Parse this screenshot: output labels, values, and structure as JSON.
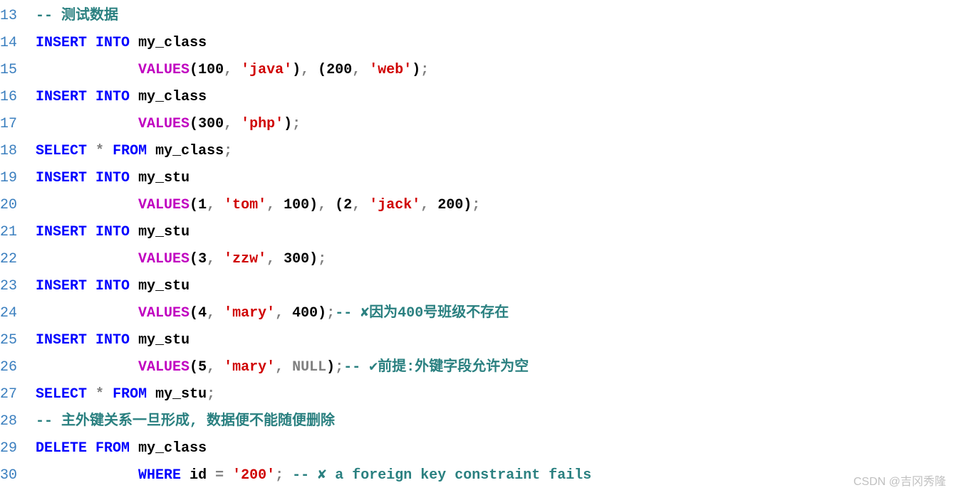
{
  "lines": [
    {
      "no": "13",
      "tokens": [
        {
          "t": "-- 测试数据",
          "c": "comment"
        }
      ]
    },
    {
      "no": "14",
      "tokens": [
        {
          "t": "INSERT",
          "c": "kw"
        },
        {
          "t": " ",
          "c": "id"
        },
        {
          "t": "INTO",
          "c": "kw"
        },
        {
          "t": " ",
          "c": "id"
        },
        {
          "t": "my_class",
          "c": "id"
        }
      ]
    },
    {
      "no": "15",
      "indent": "            ",
      "tokens": [
        {
          "t": "VALUES",
          "c": "fn"
        },
        {
          "t": "(",
          "c": "punct"
        },
        {
          "t": "100",
          "c": "num"
        },
        {
          "t": ",",
          "c": "op"
        },
        {
          "t": " ",
          "c": "id"
        },
        {
          "t": "'java'",
          "c": "str"
        },
        {
          "t": ")",
          "c": "punct"
        },
        {
          "t": ",",
          "c": "op"
        },
        {
          "t": " ",
          "c": "id"
        },
        {
          "t": "(",
          "c": "punct"
        },
        {
          "t": "200",
          "c": "num"
        },
        {
          "t": ",",
          "c": "op"
        },
        {
          "t": " ",
          "c": "id"
        },
        {
          "t": "'web'",
          "c": "str"
        },
        {
          "t": ")",
          "c": "punct"
        },
        {
          "t": ";",
          "c": "op"
        }
      ]
    },
    {
      "no": "16",
      "tokens": [
        {
          "t": "INSERT",
          "c": "kw"
        },
        {
          "t": " ",
          "c": "id"
        },
        {
          "t": "INTO",
          "c": "kw"
        },
        {
          "t": " ",
          "c": "id"
        },
        {
          "t": "my_class",
          "c": "id"
        }
      ]
    },
    {
      "no": "17",
      "indent": "            ",
      "tokens": [
        {
          "t": "VALUES",
          "c": "fn"
        },
        {
          "t": "(",
          "c": "punct"
        },
        {
          "t": "300",
          "c": "num"
        },
        {
          "t": ",",
          "c": "op"
        },
        {
          "t": " ",
          "c": "id"
        },
        {
          "t": "'php'",
          "c": "str"
        },
        {
          "t": ")",
          "c": "punct"
        },
        {
          "t": ";",
          "c": "op"
        }
      ]
    },
    {
      "no": "18",
      "tokens": [
        {
          "t": "SELECT",
          "c": "kw"
        },
        {
          "t": " ",
          "c": "id"
        },
        {
          "t": "*",
          "c": "op"
        },
        {
          "t": " ",
          "c": "id"
        },
        {
          "t": "FROM",
          "c": "kw"
        },
        {
          "t": " ",
          "c": "id"
        },
        {
          "t": "my_class",
          "c": "id"
        },
        {
          "t": ";",
          "c": "op"
        }
      ]
    },
    {
      "no": "19",
      "tokens": [
        {
          "t": "INSERT",
          "c": "kw"
        },
        {
          "t": " ",
          "c": "id"
        },
        {
          "t": "INTO",
          "c": "kw"
        },
        {
          "t": " ",
          "c": "id"
        },
        {
          "t": "my_stu",
          "c": "id"
        }
      ]
    },
    {
      "no": "20",
      "indent": "            ",
      "tokens": [
        {
          "t": "VALUES",
          "c": "fn"
        },
        {
          "t": "(",
          "c": "punct"
        },
        {
          "t": "1",
          "c": "num"
        },
        {
          "t": ",",
          "c": "op"
        },
        {
          "t": " ",
          "c": "id"
        },
        {
          "t": "'tom'",
          "c": "str"
        },
        {
          "t": ",",
          "c": "op"
        },
        {
          "t": " ",
          "c": "id"
        },
        {
          "t": "100",
          "c": "num"
        },
        {
          "t": ")",
          "c": "punct"
        },
        {
          "t": ",",
          "c": "op"
        },
        {
          "t": " ",
          "c": "id"
        },
        {
          "t": "(",
          "c": "punct"
        },
        {
          "t": "2",
          "c": "num"
        },
        {
          "t": ",",
          "c": "op"
        },
        {
          "t": " ",
          "c": "id"
        },
        {
          "t": "'jack'",
          "c": "str"
        },
        {
          "t": ",",
          "c": "op"
        },
        {
          "t": " ",
          "c": "id"
        },
        {
          "t": "200",
          "c": "num"
        },
        {
          "t": ")",
          "c": "punct"
        },
        {
          "t": ";",
          "c": "op"
        }
      ]
    },
    {
      "no": "21",
      "tokens": [
        {
          "t": "INSERT",
          "c": "kw"
        },
        {
          "t": " ",
          "c": "id"
        },
        {
          "t": "INTO",
          "c": "kw"
        },
        {
          "t": " ",
          "c": "id"
        },
        {
          "t": "my_stu",
          "c": "id"
        }
      ]
    },
    {
      "no": "22",
      "indent": "            ",
      "tokens": [
        {
          "t": "VALUES",
          "c": "fn"
        },
        {
          "t": "(",
          "c": "punct"
        },
        {
          "t": "3",
          "c": "num"
        },
        {
          "t": ",",
          "c": "op"
        },
        {
          "t": " ",
          "c": "id"
        },
        {
          "t": "'zzw'",
          "c": "str"
        },
        {
          "t": ",",
          "c": "op"
        },
        {
          "t": " ",
          "c": "id"
        },
        {
          "t": "300",
          "c": "num"
        },
        {
          "t": ")",
          "c": "punct"
        },
        {
          "t": ";",
          "c": "op"
        }
      ]
    },
    {
      "no": "23",
      "tokens": [
        {
          "t": "INSERT",
          "c": "kw"
        },
        {
          "t": " ",
          "c": "id"
        },
        {
          "t": "INTO",
          "c": "kw"
        },
        {
          "t": " ",
          "c": "id"
        },
        {
          "t": "my_stu",
          "c": "id"
        }
      ]
    },
    {
      "no": "24",
      "indent": "            ",
      "tokens": [
        {
          "t": "VALUES",
          "c": "fn"
        },
        {
          "t": "(",
          "c": "punct"
        },
        {
          "t": "4",
          "c": "num"
        },
        {
          "t": ",",
          "c": "op"
        },
        {
          "t": " ",
          "c": "id"
        },
        {
          "t": "'mary'",
          "c": "str"
        },
        {
          "t": ",",
          "c": "op"
        },
        {
          "t": " ",
          "c": "id"
        },
        {
          "t": "400",
          "c": "num"
        },
        {
          "t": ")",
          "c": "punct"
        },
        {
          "t": ";",
          "c": "op"
        },
        {
          "t": "-- ✘因为400号班级不存在",
          "c": "comment"
        }
      ]
    },
    {
      "no": "25",
      "tokens": [
        {
          "t": "INSERT",
          "c": "kw"
        },
        {
          "t": " ",
          "c": "id"
        },
        {
          "t": "INTO",
          "c": "kw"
        },
        {
          "t": " ",
          "c": "id"
        },
        {
          "t": "my_stu",
          "c": "id"
        }
      ]
    },
    {
      "no": "26",
      "indent": "            ",
      "tokens": [
        {
          "t": "VALUES",
          "c": "fn"
        },
        {
          "t": "(",
          "c": "punct"
        },
        {
          "t": "5",
          "c": "num"
        },
        {
          "t": ",",
          "c": "op"
        },
        {
          "t": " ",
          "c": "id"
        },
        {
          "t": "'mary'",
          "c": "str"
        },
        {
          "t": ",",
          "c": "op"
        },
        {
          "t": " ",
          "c": "id"
        },
        {
          "t": "NULL",
          "c": "null"
        },
        {
          "t": ")",
          "c": "punct"
        },
        {
          "t": ";",
          "c": "op"
        },
        {
          "t": "-- ✔前提:外键字段允许为空",
          "c": "comment"
        }
      ]
    },
    {
      "no": "27",
      "tokens": [
        {
          "t": "SELECT",
          "c": "kw"
        },
        {
          "t": " ",
          "c": "id"
        },
        {
          "t": "*",
          "c": "op"
        },
        {
          "t": " ",
          "c": "id"
        },
        {
          "t": "FROM",
          "c": "kw"
        },
        {
          "t": " ",
          "c": "id"
        },
        {
          "t": "my_stu",
          "c": "id"
        },
        {
          "t": ";",
          "c": "op"
        }
      ]
    },
    {
      "no": "28",
      "tokens": [
        {
          "t": "-- 主外键关系一旦形成, 数据便不能随便删除",
          "c": "comment"
        }
      ]
    },
    {
      "no": "29",
      "tokens": [
        {
          "t": "DELETE",
          "c": "kw"
        },
        {
          "t": " ",
          "c": "id"
        },
        {
          "t": "FROM",
          "c": "kw"
        },
        {
          "t": " ",
          "c": "id"
        },
        {
          "t": "my_class",
          "c": "id"
        }
      ]
    },
    {
      "no": "30",
      "indent": "            ",
      "tokens": [
        {
          "t": "WHERE",
          "c": "kw"
        },
        {
          "t": " ",
          "c": "id"
        },
        {
          "t": "id",
          "c": "id"
        },
        {
          "t": " ",
          "c": "id"
        },
        {
          "t": "=",
          "c": "op"
        },
        {
          "t": " ",
          "c": "id"
        },
        {
          "t": "'200'",
          "c": "str"
        },
        {
          "t": ";",
          "c": "op"
        },
        {
          "t": " ",
          "c": "id"
        },
        {
          "t": "-- ✘ a foreign key constraint fails",
          "c": "comment"
        }
      ]
    }
  ],
  "watermark": "CSDN @吉冈秀隆"
}
